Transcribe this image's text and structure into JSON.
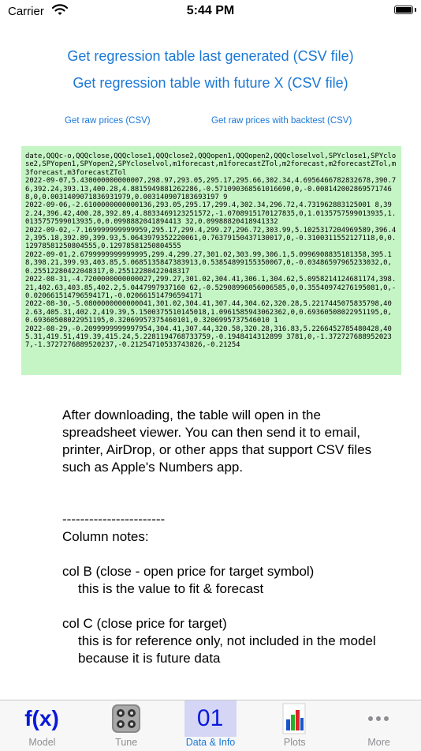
{
  "status_bar": {
    "carrier": "Carrier",
    "time": "5:44 PM"
  },
  "links": {
    "regression_last": "Get regression table last generated (CSV file)",
    "regression_future": "Get regression table with future X (CSV file)",
    "raw_prices": "Get raw prices (CSV)",
    "raw_prices_backtest": "Get raw prices with backtest (CSV)"
  },
  "csv_preview": "date,QQQc-o,QQQclose,QQQclose1,QQQclose2,QQQopen1,QQQopen2,QQQcloselvol,SPYclose1,SPYclose2,SPYopen1,SPYopen2,SPYcloselvol,m1forecast,m1forecastZTol,m2forecast,m2forecastZTol,m3forecast,m3forecastZTol\n2022-09-07,5.430000000000007,298.97,293.05,295.17,295.66,302.34,4.6956466782832678,390.76,392.24,393.13,400.28,4.8815949881262286,-0.571090368561016690,0,-0.0081420028695717468,0,0.0031409071836931979,0.003140907183693197 9\n2022-09-06,-2.6100000000000136,293.05,295.17,299.4,302.34,296.72,4.731962883125001 8,392.24,396.42,400.28,392.89,4.8833469123251572,-1.0708915170127835,0,1.0135757599013935,1.0135757599013935,0,0.0998882041894413 32,0.09988820418941332\n2022-09-02,-7.169999999999959,295.17,299.4,299.27,296.72,303.99,5.1025317204969589,396.42,395.18,392.89,399.93,5.0643979352220061,0.76379150437130017,0,-0.3100311552127118,0,0.12978581250804555,0.12978581250804555\n2022-09-01,2.6799999999999995,299.4,299.27,301.02,303.99,306.1,5.0996908835181358,395.18,398.21,399.93,403.85,5.0685135847383913,0.53854899155350067,0,-0.03486597965233032,0,0.25512280422048317,0.25512280422048317\n2022-08-31,-4.7200000000000027,299.27,301.02,304.41,306.1,304.62,5.0958214124681174,398.21,402.63,403.85,402.2,5.0447997937160 62,-0.52908996056006585,0,0.35540974276195081,0,-0.020661514796594171,-0.020661514796594171\n2022-08-30,-5.0800000000000041,301.02,304.41,307.44,304.62,320.28,5.2217445075835798,402.63,405.31,402.2,419.39,5.1500375510145018,1.0961585943062362,0,0.69360508022951195,0,0.69360508022951195,0.32069957375460101,0.3206995737546010 1\n2022-08-29,-0.2099999999997954,304.41,307.44,320.58,320.28,316.83,5.2266452785480428,405.31,419.51,419.39,415.24,5.2281194768733759,-0.1948414312899 3781,0,-1.3727276889520237,-1.3727276889520237,-0.21254710533743826,-0.21254",
  "info": {
    "paragraph": "After downloading, the table will open in the spreadsheet viewer.  You can then send it to email, printer, AirDrop, or other apps that support CSV files such as Apple's Numbers app.",
    "divider": "-----------------------",
    "column_notes_heading": "Column notes:",
    "col_b_title": "col B (close - open price for target symbol)",
    "col_b_desc": "this is the value to fit & forecast",
    "col_c_title": "col C (close price for target)",
    "col_c_desc": "this is for reference only, not included in the model because it is future data"
  },
  "tabs": [
    {
      "label": "Model",
      "icon": "fx-icon"
    },
    {
      "label": "Tune",
      "icon": "tune-icon"
    },
    {
      "label": "Data & Info",
      "icon": "data-icon",
      "active": true
    },
    {
      "label": "Plots",
      "icon": "bar-chart-icon"
    },
    {
      "label": "More",
      "icon": "more-icon"
    }
  ],
  "tab_glyphs": {
    "model": "f(x)",
    "data": "01"
  },
  "colors": {
    "link": "#1a78d6",
    "csv_background": "#c6f5c5",
    "tab_active_bg": "#d5d6f6",
    "icon_blue": "#0a1ad8"
  }
}
